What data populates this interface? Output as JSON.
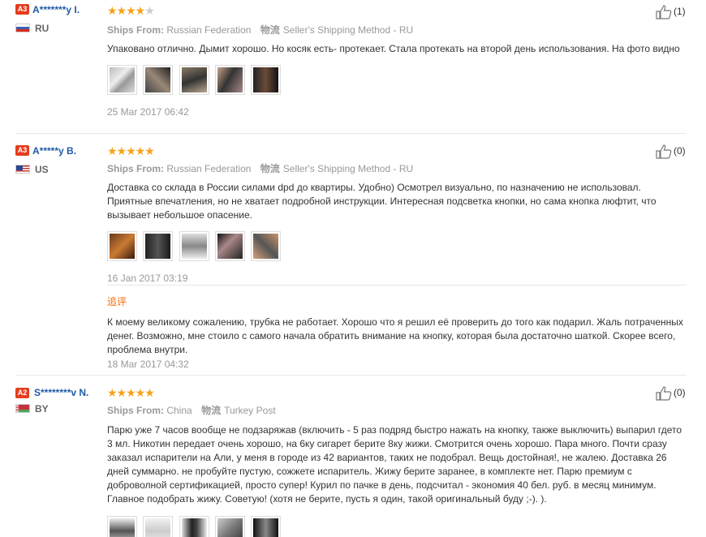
{
  "reviews": [
    {
      "badge": "A3",
      "name": "A*******y I.",
      "country": "RU",
      "stars": 4,
      "ships_from_label": "Ships From:",
      "ships_from": "Russian Federation",
      "method_label": "物流",
      "method": "Seller's Shipping Method - RU",
      "text": "Упаковано отлично. Дымит хорошо. Но косяк есть- протекает. Стала протекать на второй день использования. На фото видно",
      "photo_count": 5,
      "date": "25 Mar 2017 06:42",
      "helpful": "(1)"
    },
    {
      "badge": "A3",
      "name": "A*****y B.",
      "country": "US",
      "stars": 5,
      "ships_from_label": "Ships From:",
      "ships_from": "Russian Federation",
      "method_label": "物流",
      "method": "Seller's Shipping Method - RU",
      "text": "Доставка со склада в России силами dpd до квартиры. Удобно) Осмотрел визуально, по назначению не использовал. Приятные впечатления, но не хватает подробной инструкции. Интересная подсветка кнопки, но сама кнопка люфтит, что вызывает небольшое опасение.",
      "photo_count": 5,
      "date": "16 Jan 2017 03:19",
      "appended_label": "追评",
      "appended_text": "К моему великому сожалению, трубка не работает. Хорошо что я решил её проверить до того как подарил. Жаль потраченных денег. Возможно, мне стоило с самого начала обратить внимание на кнопку, которая была достаточно шаткой. Скорее всего, проблема внутри.",
      "appended_date": "18 Mar 2017 04:32",
      "helpful": "(0)"
    },
    {
      "badge": "A2",
      "name": "S********v N.",
      "country": "BY",
      "stars": 5,
      "ships_from_label": "Ships From:",
      "ships_from": "China",
      "method_label": "物流",
      "method": "Turkey Post",
      "text": "Парю уже 7 часов вообще не подзаряжав (включить - 5 раз подряд быстро нажать на кнопку, также выключить) выпарил гдето 3 мл. Никотин передает очень хорошо, на 6ку сигарет берите 8ку жижи. Смотрится очень хорошо. Пара много. Почти сразу заказал испарители на Али, у меня в городе из 42 вариантов, таких не подобрал. Вещь достойная!, не жалею. Доставка 26 дней суммарно. не пробуйте пустую, сожжете испаритель. Жижу берите заранее, в комплекте нет. Парю премиум с доброволной сертификацией, просто супер! Курил по пачке в день, подсчитал - экономия 40 бел. руб. в месяц минимум. Главное подобрать жижу. Советую! (хотя не берите, пусть я один, такой оригинальный буду ;-). ).",
      "photo_count": 5,
      "helpful": "(0)"
    }
  ],
  "colors": {
    "badge": "#e63c1e",
    "username": "#1f5aa8",
    "star": "#f6a21a",
    "appended_label": "#ff6600"
  },
  "icons": [
    "thumbs-up-icon",
    "flag-ru",
    "flag-us",
    "flag-by"
  ]
}
